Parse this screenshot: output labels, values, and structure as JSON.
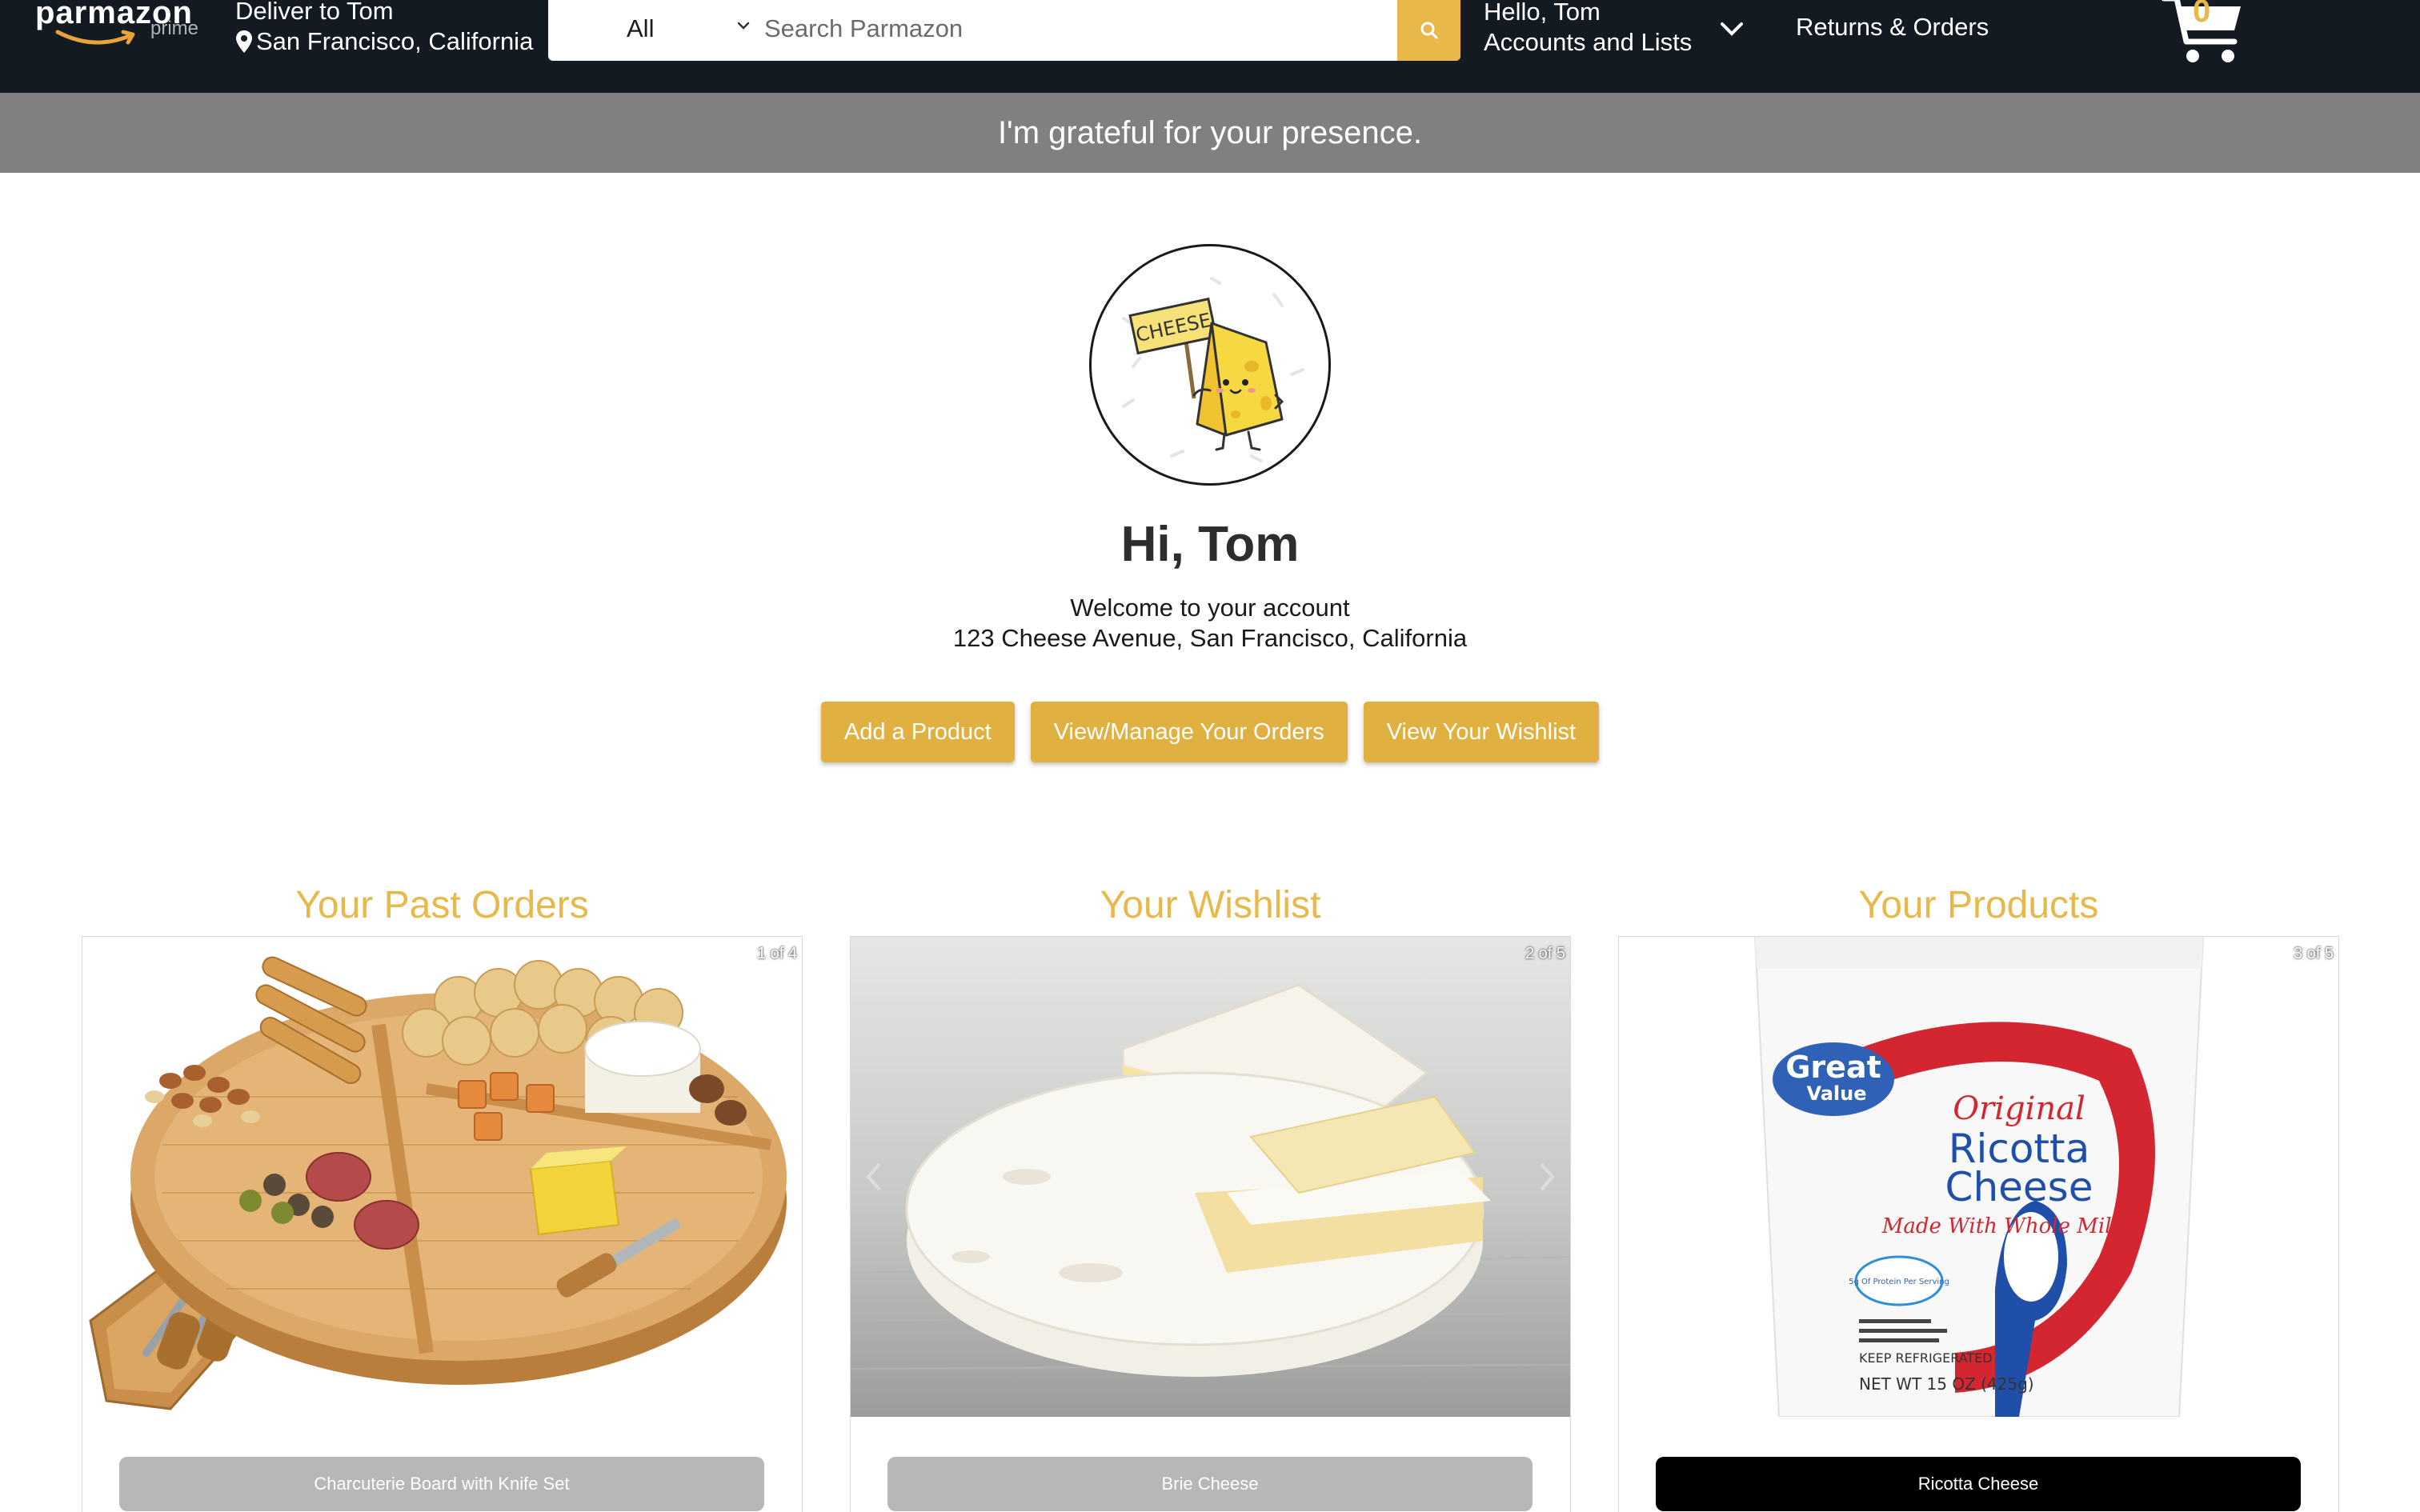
{
  "header": {
    "logo_text": "parmazon",
    "logo_sub": "prime",
    "deliver_line1": "Deliver to Tom",
    "deliver_line2": "San Francisco, California",
    "search_category": "All",
    "search_placeholder": "Search Parmazon",
    "account_line1": "Hello, Tom",
    "account_line2": "Accounts and Lists",
    "returns_label": "Returns & Orders",
    "cart_count": "0"
  },
  "banner": {
    "text": "I'm grateful for your presence."
  },
  "profile": {
    "avatar_sign": "CHEESE",
    "greeting": "Hi, Tom",
    "welcome": "Welcome to your account",
    "address": "123 Cheese Avenue, San Francisco, California"
  },
  "actions": {
    "add_product": "Add a Product",
    "manage_orders": "View/Manage Your Orders",
    "wishlist": "View Your Wishlist"
  },
  "sections": [
    {
      "title": "Your Past Orders",
      "counter": "1 of 4",
      "item": "Charcuterie Board with Knife Set",
      "image": "charcuterie-board-image"
    },
    {
      "title": "Your Wishlist",
      "counter": "2 of 5",
      "item": "Brie Cheese",
      "image": "brie-cheese-image"
    },
    {
      "title": "Your Products",
      "counter": "3 of 5",
      "item": "Ricotta Cheese",
      "image": "ricotta-tub-image"
    }
  ],
  "ricotta_tub": {
    "brand_line1": "Great",
    "brand_line2": "Value",
    "title_line1": "Original",
    "title_line2": "Ricotta",
    "title_line3": "Cheese",
    "subtitle": "Made With Whole Milk",
    "badge": "5g Of Protein Per Serving",
    "storage": "KEEP REFRIGERATED",
    "net_weight": "NET WT 15 OZ (425g)"
  },
  "colors": {
    "header_bg": "#131a22",
    "accent": "#e8b84b",
    "banner_bg": "#808080",
    "button_bg": "#e0b140"
  }
}
